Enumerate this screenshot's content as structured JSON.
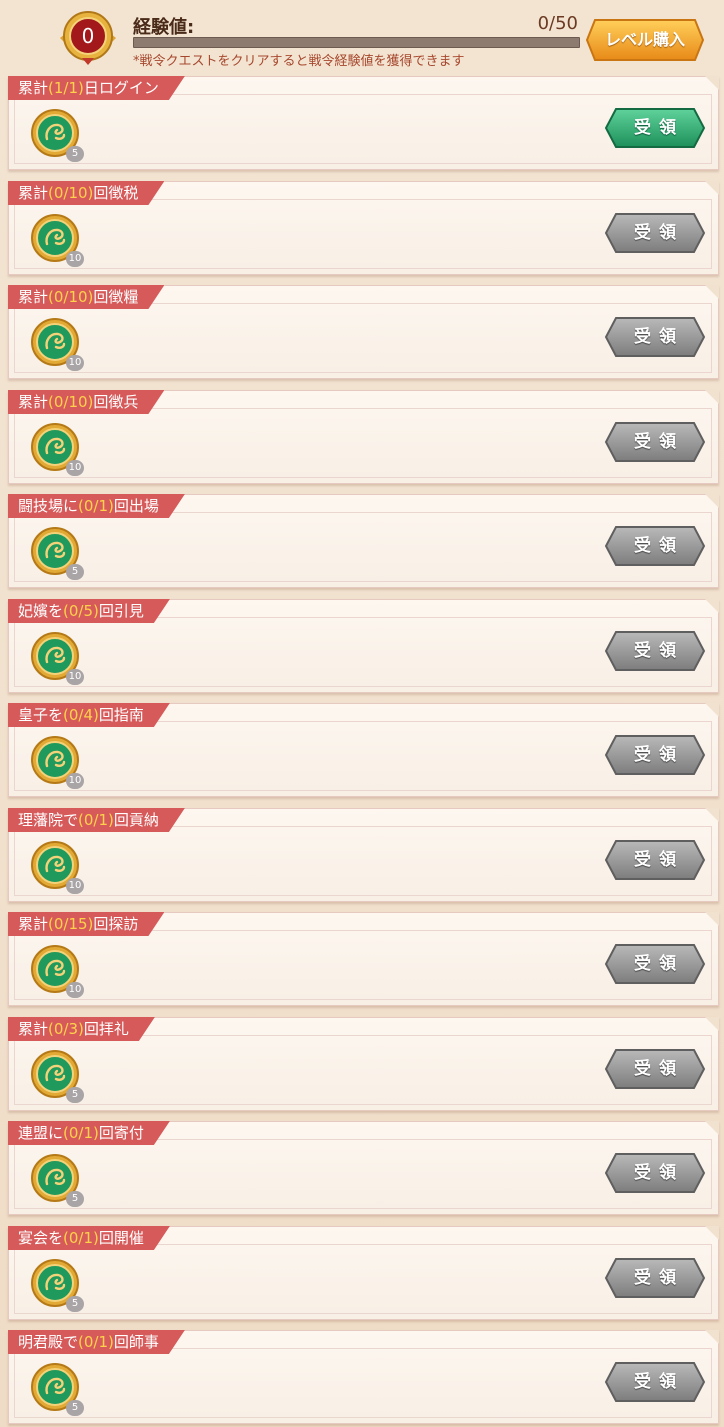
{
  "header": {
    "level": "0",
    "exp_label": "経験値:",
    "exp_count": "0/50",
    "exp_progress": 0,
    "note": "*戦令クエストをクリアすると戦令経験値を獲得できます",
    "buy_label": "レベル購入"
  },
  "colors": {
    "tag_bg": "#d65a5a",
    "tag_progress": "#ffd24a",
    "claim_active": "#2fae74",
    "claim_inactive": "#8f8f8f",
    "buy_button": "#f0a431"
  },
  "claim_label": "受領",
  "tasks": [
    {
      "pre": "累計",
      "prog": "(1/1)",
      "post": "日ログイン",
      "reward_icon": "dragon-jade-coin-icon",
      "count": "5",
      "active": true
    },
    {
      "pre": "累計",
      "prog": "(0/10)",
      "post": "回徴税",
      "reward_icon": "dragon-jade-coin-icon",
      "count": "10",
      "active": false
    },
    {
      "pre": "累計",
      "prog": "(0/10)",
      "post": "回徴糧",
      "reward_icon": "dragon-jade-coin-icon",
      "count": "10",
      "active": false
    },
    {
      "pre": "累計",
      "prog": "(0/10)",
      "post": "回徴兵",
      "reward_icon": "dragon-jade-coin-icon",
      "count": "10",
      "active": false
    },
    {
      "pre": "闘技場に",
      "prog": "(0/1)",
      "post": "回出場",
      "reward_icon": "dragon-jade-coin-icon",
      "count": "5",
      "active": false
    },
    {
      "pre": "妃嬪を",
      "prog": "(0/5)",
      "post": "回引見",
      "reward_icon": "dragon-jade-coin-icon",
      "count": "10",
      "active": false
    },
    {
      "pre": "皇子を",
      "prog": "(0/4)",
      "post": "回指南",
      "reward_icon": "dragon-jade-coin-icon",
      "count": "10",
      "active": false
    },
    {
      "pre": "理藩院で",
      "prog": "(0/1)",
      "post": "回貢納",
      "reward_icon": "dragon-jade-coin-icon",
      "count": "10",
      "active": false
    },
    {
      "pre": "累計",
      "prog": "(0/15)",
      "post": "回探訪",
      "reward_icon": "dragon-jade-coin-icon",
      "count": "10",
      "active": false
    },
    {
      "pre": "累計",
      "prog": "(0/3)",
      "post": "回拝礼",
      "reward_icon": "dragon-jade-coin-icon",
      "count": "5",
      "active": false
    },
    {
      "pre": "連盟に",
      "prog": "(0/1)",
      "post": "回寄付",
      "reward_icon": "dragon-jade-coin-icon",
      "count": "5",
      "active": false
    },
    {
      "pre": "宴会を",
      "prog": "(0/1)",
      "post": "回開催",
      "reward_icon": "dragon-jade-coin-icon",
      "count": "5",
      "active": false
    },
    {
      "pre": "明君殿で",
      "prog": "(0/1)",
      "post": "回師事",
      "reward_icon": "dragon-jade-coin-icon",
      "count": "5",
      "active": false
    }
  ]
}
